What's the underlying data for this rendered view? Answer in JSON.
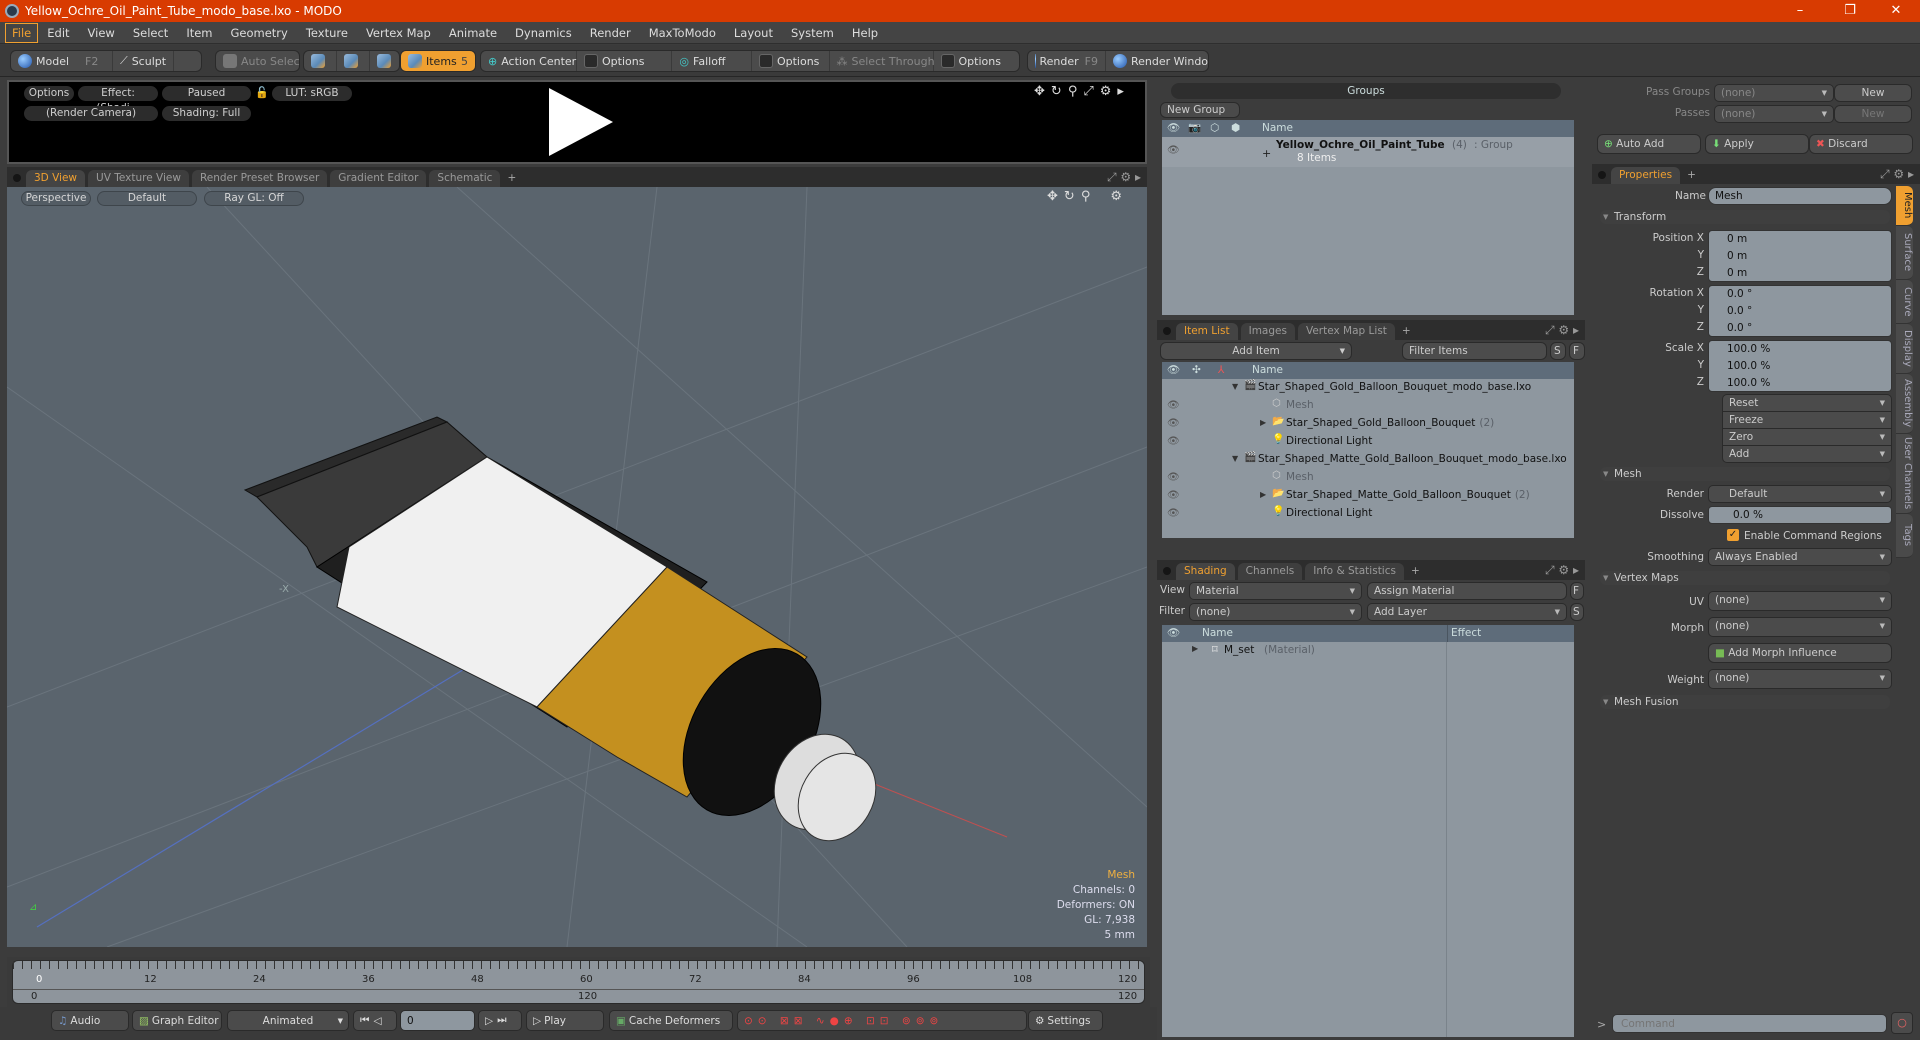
{
  "window": {
    "title": "Yellow_Ochre_Oil_Paint_Tube_modo_base.lxo - MODO",
    "controls": [
      "–",
      "❐",
      "✕"
    ]
  },
  "menu": [
    "File",
    "Edit",
    "View",
    "Select",
    "Item",
    "Geometry",
    "Texture",
    "Vertex Map",
    "Animate",
    "Dynamics",
    "Render",
    "MaxToModo",
    "Layout",
    "System",
    "Help"
  ],
  "toolbar": {
    "model": "Model",
    "model_key": "F2",
    "sculpt": "Sculpt",
    "auto_select": "Auto Select",
    "items": "Items",
    "items_count": "5",
    "action_center": "Action Center",
    "options1": "Options",
    "falloff": "Falloff",
    "options2": "Options",
    "select_through": "Select Through",
    "options3": "Options",
    "render": "Render",
    "render_key": "F9",
    "render_window": "Render Window"
  },
  "preview": {
    "options": "Options",
    "effect": "Effect: (Shadi...",
    "paused": "Paused",
    "lut": "LUT: sRGB",
    "camera": "(Render Camera)",
    "shading": "Shading: Full"
  },
  "viewport_tabs": [
    "3D View",
    "UV Texture View",
    "Render Preset Browser",
    "Gradient Editor",
    "Schematic",
    "+"
  ],
  "viewport": {
    "projection": "Perspective",
    "style": "Default",
    "raygl": "Ray GL: Off",
    "axis_label": "-X",
    "info": {
      "selection": "Mesh",
      "channels": "Channels: 0",
      "deformers": "Deformers: ON",
      "gl": "GL: 7,938",
      "scale": "5 mm"
    }
  },
  "timeline": {
    "ticks": [
      "0",
      "12",
      "24",
      "36",
      "48",
      "60",
      "72",
      "84",
      "96",
      "108",
      "120"
    ],
    "range_start": "0",
    "range_mid": "120",
    "range_end": "120"
  },
  "transport": {
    "audio": "Audio",
    "graph_editor": "Graph Editor",
    "mode": "Animated",
    "frame": "0",
    "play": "Play",
    "cache": "Cache Deformers",
    "settings": "Settings"
  },
  "groups": {
    "title": "Groups",
    "new_group": "New Group",
    "col_name": "Name",
    "group_name": "Yellow_Ochre_Oil_Paint_Tube",
    "group_count": "(4)",
    "group_type": ": Group",
    "group_items": "8 Items"
  },
  "itemlist": {
    "tabs": [
      "Item List",
      "Images",
      "Vertex Map List",
      "+"
    ],
    "add_item": "Add Item",
    "filter": "Filter Items",
    "s": "S",
    "f": "F",
    "col_name": "Name",
    "rows": [
      {
        "text": "Star_Shaped_Gold_Balloon_Bouquet_modo_base.lxo",
        "count": "",
        "level": 0,
        "kind": "scene"
      },
      {
        "text": "Mesh",
        "count": "",
        "level": 1,
        "kind": "mesh"
      },
      {
        "text": "Star_Shaped_Gold_Balloon_Bouquet",
        "count": "(2)",
        "level": 1,
        "kind": "group"
      },
      {
        "text": "Directional Light",
        "count": "",
        "level": 1,
        "kind": "light"
      },
      {
        "text": "Star_Shaped_Matte_Gold_Balloon_Bouquet_modo_base.lxo",
        "count": "",
        "level": 0,
        "kind": "scene"
      },
      {
        "text": "Mesh",
        "count": "",
        "level": 1,
        "kind": "mesh"
      },
      {
        "text": "Star_Shaped_Matte_Gold_Balloon_Bouquet",
        "count": "(2)",
        "level": 1,
        "kind": "group"
      },
      {
        "text": "Directional Light",
        "count": "",
        "level": 1,
        "kind": "light"
      }
    ]
  },
  "shading": {
    "tabs": [
      "Shading",
      "Channels",
      "Info & Statistics",
      "+"
    ],
    "view_label": "View",
    "view_value": "Material",
    "assign": "Assign Material",
    "filter_label": "Filter",
    "filter_value": "(none)",
    "add_layer": "Add Layer",
    "col_name": "Name",
    "col_effect": "Effect",
    "row_name": "M_set",
    "row_type": "(Material)"
  },
  "passes": {
    "pass_groups": "Pass Groups",
    "passes": "Passes",
    "none": "(none)",
    "new": "New",
    "auto_add": "Auto Add",
    "apply": "Apply",
    "discard": "Discard"
  },
  "properties": {
    "tab": "Properties",
    "name_label": "Name",
    "name_value": "Mesh",
    "transform": "Transform",
    "position_label": "Position X",
    "rotation_label": "Rotation X",
    "scale_label": "Scale X",
    "y": "Y",
    "z": "Z",
    "position": [
      "0 m",
      "0 m",
      "0 m"
    ],
    "rotation": [
      "0.0 °",
      "0.0 °",
      "0.0 °"
    ],
    "scale": [
      "100.0 %",
      "100.0 %",
      "100.0 %"
    ],
    "actions": [
      "Reset",
      "Freeze",
      "Zero",
      "Add"
    ],
    "mesh": "Mesh",
    "render_label": "Render",
    "render_value": "Default",
    "dissolve_label": "Dissolve",
    "dissolve_value": "0.0 %",
    "enable_cmd": "Enable Command Regions",
    "smoothing_label": "Smoothing",
    "smoothing_value": "Always Enabled",
    "vertex_maps": "Vertex Maps",
    "uv_label": "UV",
    "morph_label": "Morph",
    "weight_label": "Weight",
    "none": "(none)",
    "add_morph": "Add Morph Influence",
    "mesh_fusion": "Mesh Fusion",
    "side_tabs": [
      "Mesh",
      "Surface",
      "Curve",
      "Display",
      "Assembly",
      "User Channels",
      "Tags"
    ]
  },
  "command": {
    "prompt": ">",
    "placeholder": "Command"
  }
}
